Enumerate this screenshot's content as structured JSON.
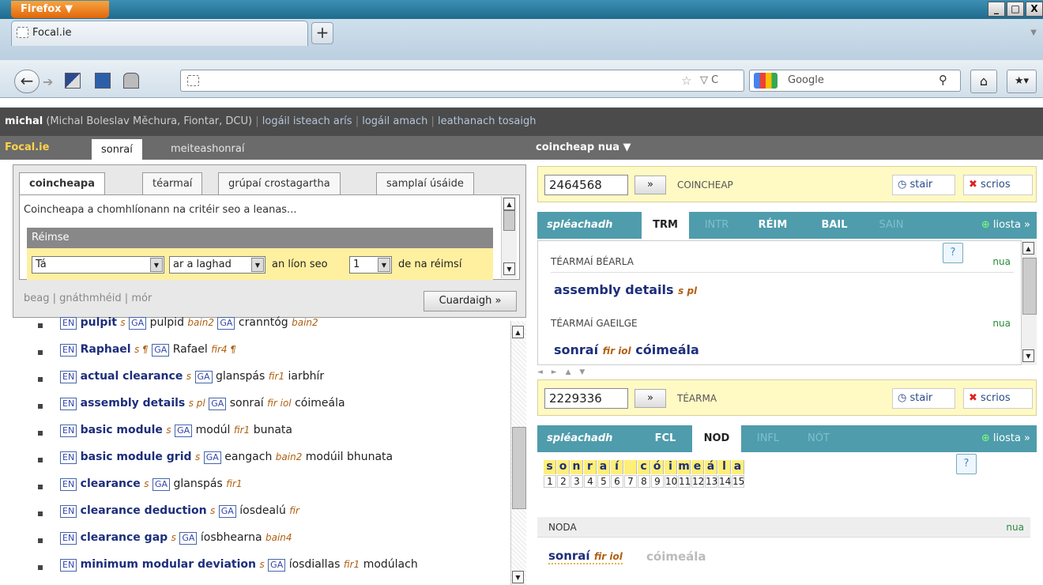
{
  "browser": {
    "menu_label": "Firefox ▼",
    "tab_title": "Focal.ie",
    "newtab_label": "+",
    "search_engine": "Google",
    "win_min": "_",
    "win_max": "□",
    "win_close": "X"
  },
  "userbar": {
    "username": "michal",
    "fullname": " (Michal Boleslav Měchura, Fiontar, DCU)",
    "sep": " | ",
    "links": [
      "logáil isteach arís",
      "logáil amach",
      "leathanach tosaigh"
    ]
  },
  "menubar": {
    "brand": "Focal.ie",
    "tabs": [
      "sonraí",
      "meiteashonraí"
    ],
    "new_concept": "coincheap nua ▼"
  },
  "search": {
    "tabs": [
      "coincheapa",
      "téarmaí",
      "grúpaí crostagartha",
      "samplaí úsáide"
    ],
    "hint": "Coincheapa a chomhlíonann na critéir seo a leanas...",
    "field_header": "Réimse",
    "select1": "Tá",
    "select2": "ar a laghad",
    "text1": "an líon seo",
    "select3": "1",
    "text2": "de na réimsí",
    "sizes": "beag | gnáthmhéid | mór",
    "button": "Cuardaigh »"
  },
  "results": [
    {
      "en": "pulpit",
      "egr": "s",
      "ga": "pulpid",
      "ggr": "bain2",
      "extra_ga": "cranntóg",
      "extra_gr": "bain2"
    },
    {
      "en": "Raphael",
      "egr": "s ¶",
      "ga": "Rafael",
      "ggr": "fir4 ¶"
    },
    {
      "en": "actual clearance",
      "egr": "s",
      "ga": "glanspás",
      "ggr": "fir1",
      "tail": "iarbhír"
    },
    {
      "en": "assembly details",
      "egr": "s pl",
      "ga": "sonraí",
      "ggr": "fir iol",
      "tail": "cóimeála"
    },
    {
      "en": "basic module",
      "egr": "s",
      "ga": "modúl",
      "ggr": "fir1",
      "tail": "bunata"
    },
    {
      "en": "basic module grid",
      "egr": "s",
      "ga": "eangach",
      "ggr": "bain2",
      "tail": "modúil bhunata"
    },
    {
      "en": "clearance",
      "egr": "s",
      "ga": "glanspás",
      "ggr": "fir1"
    },
    {
      "en": "clearance deduction",
      "egr": "s",
      "ga": "íosdealú",
      "ggr": "fir"
    },
    {
      "en": "clearance gap",
      "egr": "s",
      "ga": "íosbhearna",
      "ggr": "bain4"
    },
    {
      "en": "minimum modular deviation",
      "egr": "s",
      "ga": "íosdiallas",
      "ggr": "fir1",
      "tail": "modúlach"
    }
  ],
  "lang_tags": {
    "en": "EN",
    "ga": "GA"
  },
  "concept": {
    "id": "2464568",
    "go": "»",
    "type": "COINCHEAP",
    "stair": "stair",
    "scrios": "scrios",
    "preview": "spléachadh",
    "tabs": [
      "TRM",
      "INTR",
      "RÉIM",
      "BAIL",
      "SAIN"
    ],
    "liosta": "liosta »",
    "en_header": "TÉARMAÍ BÉARLA",
    "en_term": "assembly details",
    "en_gram": "s pl",
    "ga_header": "TÉARMAÍ GAEILGE",
    "ga_term": "sonraí",
    "ga_gram": "fir iol",
    "ga_tail": "cóimeála",
    "nua": "nua"
  },
  "term": {
    "id": "2229336",
    "go": "»",
    "type": "TÉARMA",
    "stair": "stair",
    "scrios": "scrios",
    "preview": "spléachadh",
    "tabs": [
      "FCL",
      "NOD",
      "INFL",
      "NÓT"
    ],
    "liosta": "liosta »",
    "letters": [
      "s",
      "o",
      "n",
      "r",
      "a",
      "í",
      " ",
      "c",
      "ó",
      "i",
      "m",
      "e",
      "á",
      "l",
      "a"
    ],
    "numbers": [
      "1",
      "2",
      "3",
      "4",
      "5",
      "6",
      "7",
      "8",
      "9",
      "10",
      "11",
      "12",
      "13",
      "14",
      "15"
    ],
    "noda_header": "NODA",
    "nua": "nua",
    "noda_term": "sonraí",
    "noda_gram": "fir iol",
    "noda_tail": "cóimeála"
  },
  "splitter": "◄ ► ▲ ▼"
}
